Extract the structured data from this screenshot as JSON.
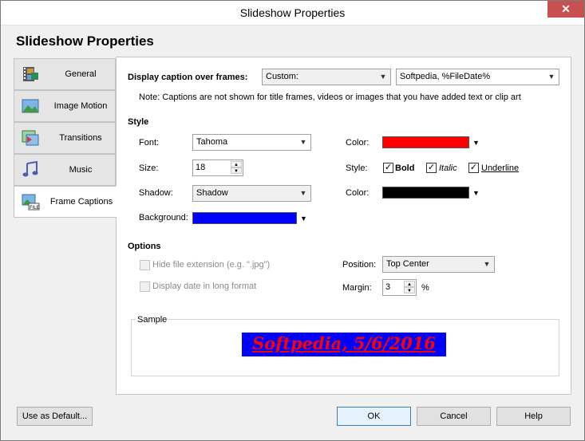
{
  "window": {
    "title": "Slideshow Properties",
    "close_glyph": "✕"
  },
  "heading": "Slideshow Properties",
  "tabs": [
    {
      "label": "General",
      "icon": "film-icon"
    },
    {
      "label": "Image Motion",
      "icon": "landscape-icon"
    },
    {
      "label": "Transitions",
      "icon": "transition-icon"
    },
    {
      "label": "Music",
      "icon": "music-note-icon"
    },
    {
      "label": "Frame Captions",
      "icon": "file-caption-icon"
    }
  ],
  "caption": {
    "label": "Display caption over frames:",
    "mode_value": "Custom:",
    "text_value": "Softpedia, %FileDate%",
    "note": "Note: Captions are not shown for title frames, videos or images that you have added text or clip art"
  },
  "style": {
    "section": "Style",
    "font_label": "Font:",
    "font_value": "Tahoma",
    "size_label": "Size:",
    "size_value": "18",
    "shadow_label": "Shadow:",
    "shadow_value": "Shadow",
    "background_label": "Background:",
    "color_label": "Color:",
    "style_label": "Style:",
    "shadow_color_label": "Color:",
    "bold_label": "Bold",
    "italic_label": "Italic",
    "underline_label": "Underline",
    "text_color": "#ff0000",
    "shadow_color": "#000000",
    "background_color": "#0000ff"
  },
  "options": {
    "section": "Options",
    "hide_ext_label": "Hide file extension (e.g. \".jpg\")",
    "long_date_label": "Display date in long format",
    "position_label": "Position:",
    "position_value": "Top Center",
    "margin_label": "Margin:",
    "margin_value": "3",
    "margin_unit": "%"
  },
  "sample": {
    "label": "Sample",
    "text": "Softpedia, 5/6/2016"
  },
  "buttons": {
    "default": "Use as Default...",
    "ok": "OK",
    "cancel": "Cancel",
    "help": "Help"
  }
}
